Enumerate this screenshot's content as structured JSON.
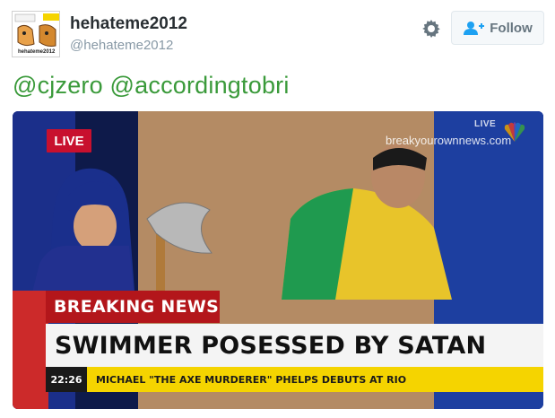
{
  "user": {
    "display_name": "hehateme2012",
    "handle": "@hehateme2012",
    "avatar_caption": "hehateme2012"
  },
  "header": {
    "follow_label": "Follow",
    "settings_icon": "gear-icon",
    "follow_icon": "add-user-icon"
  },
  "tweet": {
    "mentions": [
      "@cjzero",
      "@accordingtobri"
    ],
    "mention_color": "#3a9a3a"
  },
  "media": {
    "live_badge": "LIVE",
    "watermark": "breakyourownnews.com",
    "network_live": "LIVE",
    "breaking_label": "BREAKING NEWS",
    "headline": "SWIMMER POSESSED BY SATAN",
    "time": "22:26",
    "ticker": "MICHAEL \"THE AXE MURDERER\" PHELPS DEBUTS AT RIO",
    "colors": {
      "breaking_red": "#b3161b",
      "live_red": "#c8102e",
      "ticker_yellow": "#f5d400",
      "backdrop_blue": "#1b2f8a"
    }
  }
}
